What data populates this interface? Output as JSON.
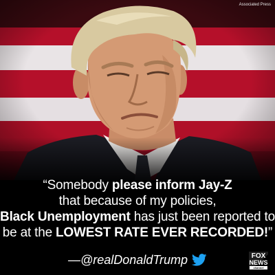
{
  "photo": {
    "description": "man in a dark suit and white shirt in front of a red and white striped flag backdrop",
    "credit": "Associated Press",
    "colors": {
      "stripe_red": "#b5102a",
      "stripe_white": "#e9e4e6",
      "suit": "#1c1d24",
      "hair": "#d8c9a0",
      "skin": "#d49a74"
    }
  },
  "caption": {
    "open_quote": "“",
    "line1_a": "Somebody ",
    "line1_b": "please inform Jay-Z",
    "line2": "that because of my policies,",
    "line3_a": "Black Unemployment",
    "line3_b": " has just been reported to",
    "line4_a": "be at the ",
    "line4_b": "LOWEST RATE EVER RECORDED!",
    "close_quote": "”"
  },
  "attribution": {
    "handle": "—@realDonaldTrump",
    "icon": "twitter-bird-icon",
    "icon_color": "#1da1f2"
  },
  "logo": {
    "icon": "fox-news-logo",
    "line1": "FOX",
    "line2": "NEWS",
    "line3": "channel"
  }
}
